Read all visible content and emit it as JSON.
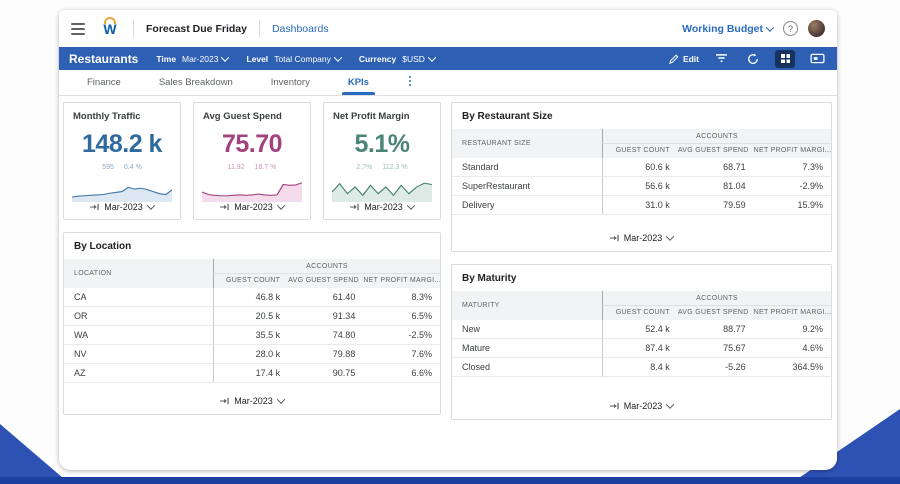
{
  "topbar": {
    "title": "Forecast Due Friday",
    "nav_link": "Dashboards",
    "budget_label": "Working Budget",
    "help_glyph": "?"
  },
  "toolbar": {
    "title": "Restaurants",
    "time_label": "Time",
    "time_value": "Mar-2023",
    "level_label": "Level",
    "level_value": "Total Company",
    "currency_label": "Currency",
    "currency_value": "$USD",
    "edit_label": "Edit"
  },
  "tabs": [
    {
      "label": "Finance",
      "active": false
    },
    {
      "label": "Sales Breakdown",
      "active": false
    },
    {
      "label": "Inventory",
      "active": false
    },
    {
      "label": "KPIs",
      "active": true
    }
  ],
  "period_value": "Mar-2023",
  "colors": {
    "toolbar_blue": "#2d5fb3",
    "link_blue": "#2a6bbf",
    "backdrop_blue": "#2e52b4",
    "backdrop_bar": "#1b3f9e"
  },
  "kpis": [
    {
      "title": "Monthly Traffic",
      "value": "148.2 k",
      "sub1": "595",
      "sub2": "0.4 %",
      "period": "Mar-2023",
      "color": "#2f6a9e",
      "sub_color": "#8aa8c4",
      "line": "#3d77a8",
      "fill": "#dde8f2",
      "spark": [
        24,
        23,
        22.5,
        22,
        21.5,
        21,
        19.5,
        18.5,
        17.5,
        12.5,
        14.5,
        13.5,
        15,
        17.5,
        20,
        21,
        15.5
      ]
    },
    {
      "title": "Avg Guest Spend",
      "value": "75.70",
      "sub1": "11.92",
      "sub2": "18.7 %",
      "period": "Mar-2023",
      "color": "#a2427e",
      "sub_color": "#c795b5",
      "line": "#a2427e",
      "fill": "#f5dcec",
      "spark": [
        18,
        21,
        22,
        22.5,
        22.5,
        22,
        21.5,
        22,
        21.5,
        20.5,
        21.5,
        22,
        21.5,
        9,
        10,
        9.5,
        7
      ]
    },
    {
      "title": "Net Profit Margin",
      "value": "5.1%",
      "sub1": "2.7%",
      "sub2": "112.3 %",
      "period": "Mar-2023",
      "color": "#4a8577",
      "sub_color": "#9bbfb4",
      "line": "#4a8577",
      "fill": "#ddeae5",
      "spark": [
        18,
        8,
        20,
        12,
        22,
        10,
        20,
        12,
        22,
        10,
        20,
        12,
        7.5,
        9
      ]
    }
  ],
  "tables": [
    {
      "id": "size",
      "title": "By Restaurant Size",
      "first_col": "RESTAURANT SIZE",
      "accounts_label": "ACCOUNTS",
      "columns": [
        "GUEST COUNT",
        "AVG GUEST SPEND",
        "NET PROFIT MARGI..."
      ],
      "rows": [
        [
          "Standard",
          "60.6 k",
          "68.71",
          "7.3%"
        ],
        [
          "SuperRestaurant",
          "56.6 k",
          "81.04",
          "-2.9%"
        ],
        [
          "Delivery",
          "31.0 k",
          "79.59",
          "15.9%"
        ]
      ],
      "period": "Mar-2023"
    },
    {
      "id": "location",
      "title": "By Location",
      "first_col": "LOCATION",
      "accounts_label": "ACCOUNTS",
      "columns": [
        "GUEST COUNT",
        "AVG GUEST SPEND",
        "NET PROFIT MARGI..."
      ],
      "rows": [
        [
          "CA",
          "46.8 k",
          "61.40",
          "8.3%"
        ],
        [
          "OR",
          "20.5 k",
          "91.34",
          "6.5%"
        ],
        [
          "WA",
          "35.5 k",
          "74.80",
          "-2.5%"
        ],
        [
          "NV",
          "28.0 k",
          "79.88",
          "7.6%"
        ],
        [
          "AZ",
          "17.4 k",
          "90.75",
          "6.6%"
        ]
      ],
      "period": "Mar-2023"
    },
    {
      "id": "maturity",
      "title": "By Maturity",
      "first_col": "MATURITY",
      "accounts_label": "ACCOUNTS",
      "columns": [
        "GUEST COUNT",
        "AVG GUEST SPEND",
        "NET PROFIT MARGI..."
      ],
      "rows": [
        [
          "New",
          "52.4 k",
          "88.77",
          "9.2%"
        ],
        [
          "Mature",
          "87.4 k",
          "75.67",
          "4.6%"
        ],
        [
          "Closed",
          "8.4 k",
          "-5.26",
          "364.5%"
        ]
      ],
      "period": "Mar-2023"
    }
  ]
}
